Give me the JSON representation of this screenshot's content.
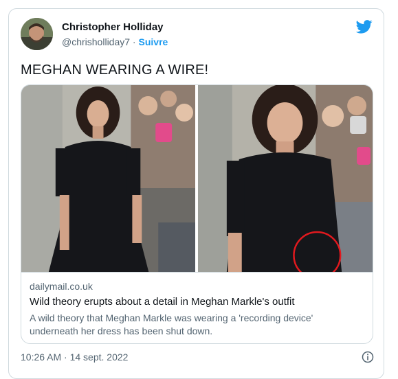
{
  "author": {
    "name": "Christopher Holliday",
    "handle": "@chrisholliday7",
    "separator": " · ",
    "follow_label": "Suivre"
  },
  "tweet": {
    "text": "MEGHAN WEARING A WIRE!",
    "timestamp": "10:26 AM · 14 sept. 2022"
  },
  "card": {
    "domain": "dailymail.co.uk",
    "title": "Wild theory erupts about a detail in Meghan Markle's outfit",
    "description": "A wild theory that Meghan Markle was wearing a 'recording device' underneath her dress has been shut down."
  },
  "colors": {
    "accent": "#1d9bf0",
    "secondary_text": "#536471",
    "border": "#cfd9de",
    "highlight_circle": "#e0191e"
  },
  "icons": {
    "brand": "twitter-bird-icon",
    "info": "info-icon"
  }
}
